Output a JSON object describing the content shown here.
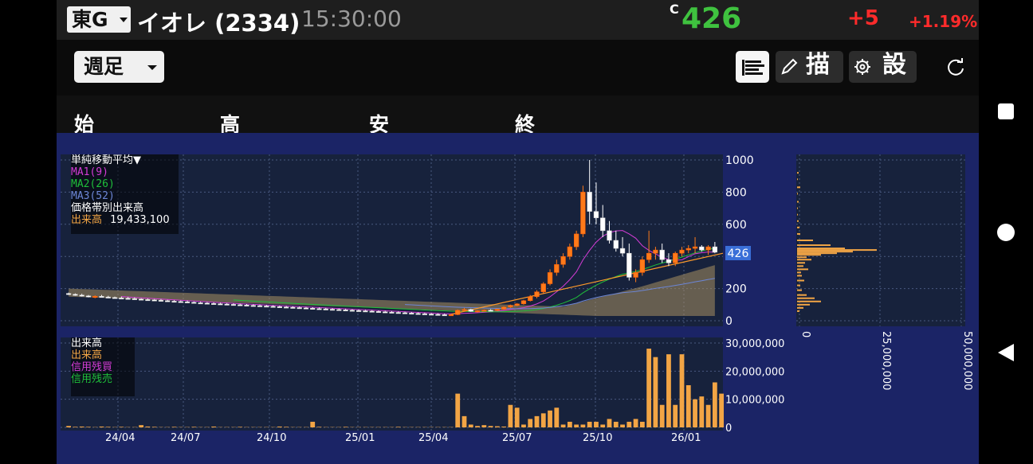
{
  "header": {
    "market": "東G",
    "title": "イオレ (2334)",
    "time": "15:30:00",
    "c_mark": "C",
    "price": "426",
    "change": "+5",
    "change_pct": "+1.19%"
  },
  "toolbar": {
    "period": "週足",
    "draw_label": "描",
    "settings_label": "設"
  },
  "ohlc_labels": [
    "始",
    "高",
    "安",
    "終"
  ],
  "legend_main": {
    "indicator": "単純移動平均▼",
    "ma1": "MA1(9)",
    "ma2": "MA2(26)",
    "ma3": "MA3(52)",
    "vol_profile": "価格帯別出来高",
    "volume_label": "出来高",
    "volume_value": "19,433,100"
  },
  "legend_volume": {
    "title": "出来高",
    "volume": "出来高",
    "margin_buy": "信用残買",
    "margin_sell": "信用残売"
  },
  "current_price_tag": "426",
  "colors": {
    "up": "#ff7a1a",
    "down": "#ffffff",
    "ma1": "#d43cd6",
    "ma2": "#1fbf3a",
    "ma3": "#6c86d6",
    "volume": "#f2a545",
    "background": "#1b2466",
    "plot": "#17223c"
  },
  "chart_data": {
    "type": "candlestick",
    "x_tick_labels": [
      "24/04",
      "24/07",
      "24/10",
      "25/01",
      "25/04",
      "25/07",
      "25/10",
      "26/01"
    ],
    "price_axis": {
      "ticks": [
        "1000",
        "800",
        "600",
        "400",
        "200",
        "0"
      ],
      "ylim": [
        0,
        1000
      ]
    },
    "volume_axis": {
      "ticks": [
        "30,000,000",
        "20,000,000",
        "10,000,000",
        "0"
      ],
      "ylim": [
        0,
        30000000
      ]
    },
    "profile_axis": {
      "ticks": [
        "0",
        "25,000,000",
        "50,000,000"
      ],
      "xlim": [
        0,
        50000000
      ]
    },
    "candles": [
      [
        170,
        175,
        160,
        165
      ],
      [
        165,
        170,
        155,
        160
      ],
      [
        160,
        168,
        150,
        155
      ],
      [
        155,
        160,
        145,
        150
      ],
      [
        150,
        158,
        140,
        152
      ],
      [
        152,
        160,
        145,
        148
      ],
      [
        148,
        155,
        140,
        145
      ],
      [
        145,
        150,
        138,
        142
      ],
      [
        142,
        150,
        135,
        140
      ],
      [
        140,
        148,
        132,
        138
      ],
      [
        138,
        145,
        130,
        135
      ],
      [
        135,
        140,
        128,
        132
      ],
      [
        132,
        138,
        125,
        130
      ],
      [
        130,
        135,
        122,
        128
      ],
      [
        128,
        135,
        120,
        125
      ],
      [
        125,
        130,
        118,
        122
      ],
      [
        122,
        128,
        115,
        120
      ],
      [
        120,
        126,
        112,
        118
      ],
      [
        118,
        125,
        110,
        115
      ],
      [
        115,
        120,
        108,
        112
      ],
      [
        112,
        118,
        105,
        110
      ],
      [
        110,
        116,
        104,
        108
      ],
      [
        108,
        114,
        102,
        106
      ],
      [
        106,
        112,
        100,
        104
      ],
      [
        104,
        110,
        98,
        102
      ],
      [
        102,
        108,
        96,
        100
      ],
      [
        100,
        106,
        94,
        98
      ],
      [
        98,
        104,
        92,
        96
      ],
      [
        96,
        102,
        90,
        94
      ],
      [
        94,
        100,
        88,
        92
      ],
      [
        92,
        98,
        86,
        90
      ],
      [
        90,
        96,
        85,
        88
      ],
      [
        88,
        94,
        83,
        86
      ],
      [
        86,
        92,
        81,
        84
      ],
      [
        84,
        90,
        80,
        82
      ],
      [
        82,
        88,
        78,
        80
      ],
      [
        80,
        86,
        76,
        78
      ],
      [
        78,
        84,
        74,
        76
      ],
      [
        76,
        82,
        72,
        74
      ],
      [
        74,
        80,
        70,
        72
      ],
      [
        72,
        78,
        68,
        70
      ],
      [
        70,
        76,
        66,
        68
      ],
      [
        68,
        74,
        64,
        66
      ],
      [
        66,
        72,
        62,
        64
      ],
      [
        64,
        70,
        60,
        62
      ],
      [
        62,
        68,
        58,
        60
      ],
      [
        60,
        66,
        56,
        58
      ],
      [
        58,
        64,
        54,
        56
      ],
      [
        56,
        62,
        52,
        54
      ],
      [
        54,
        60,
        50,
        52
      ],
      [
        52,
        58,
        48,
        50
      ],
      [
        50,
        56,
        46,
        48
      ],
      [
        48,
        54,
        44,
        46
      ],
      [
        46,
        52,
        42,
        44
      ],
      [
        44,
        50,
        40,
        42
      ],
      [
        42,
        48,
        38,
        40
      ],
      [
        40,
        46,
        36,
        38
      ],
      [
        38,
        44,
        35,
        36
      ],
      [
        36,
        42,
        34,
        38
      ],
      [
        38,
        70,
        35,
        65
      ],
      [
        65,
        80,
        60,
        70
      ],
      [
        70,
        75,
        55,
        58
      ],
      [
        58,
        66,
        52,
        62
      ],
      [
        62,
        70,
        58,
        66
      ],
      [
        66,
        72,
        60,
        64
      ],
      [
        64,
        75,
        60,
        72
      ],
      [
        72,
        90,
        68,
        85
      ],
      [
        85,
        100,
        80,
        95
      ],
      [
        95,
        110,
        90,
        105
      ],
      [
        105,
        130,
        100,
        125
      ],
      [
        125,
        160,
        120,
        150
      ],
      [
        150,
        190,
        140,
        180
      ],
      [
        180,
        240,
        170,
        230
      ],
      [
        230,
        320,
        220,
        300
      ],
      [
        300,
        380,
        280,
        350
      ],
      [
        350,
        420,
        330,
        400
      ],
      [
        400,
        480,
        380,
        460
      ],
      [
        460,
        560,
        440,
        540
      ],
      [
        540,
        840,
        520,
        800
      ],
      [
        800,
        1000,
        600,
        680
      ],
      [
        680,
        860,
        600,
        640
      ],
      [
        640,
        720,
        520,
        560
      ],
      [
        560,
        620,
        480,
        500
      ],
      [
        500,
        560,
        430,
        450
      ],
      [
        450,
        520,
        400,
        420
      ],
      [
        420,
        480,
        250,
        270
      ],
      [
        270,
        320,
        240,
        300
      ],
      [
        300,
        400,
        280,
        380
      ],
      [
        380,
        560,
        360,
        420
      ],
      [
        420,
        460,
        380,
        440
      ],
      [
        440,
        480,
        360,
        380
      ],
      [
        380,
        420,
        340,
        360
      ],
      [
        360,
        430,
        340,
        420
      ],
      [
        420,
        460,
        400,
        440
      ],
      [
        440,
        470,
        420,
        450
      ],
      [
        450,
        520,
        420,
        460
      ],
      [
        460,
        470,
        430,
        440
      ],
      [
        440,
        470,
        410,
        460
      ],
      [
        460,
        490,
        420,
        426
      ]
    ],
    "volume": [
      0.5,
      0.2,
      0.3,
      0.2,
      0.1,
      0.3,
      0.2,
      0.1,
      0.2,
      0.1,
      0.1,
      0.8,
      0.3,
      0.2,
      0.1,
      0.1,
      0.2,
      0.1,
      0.1,
      0.2,
      0.1,
      0.1,
      0.3,
      0.1,
      0.1,
      0.1,
      0.2,
      0.1,
      0.1,
      0.1,
      0.1,
      0.1,
      0.3,
      0.2,
      0.1,
      0.1,
      0.1,
      2.0,
      0.2,
      0.1,
      0.1,
      0.1,
      0.2,
      0.1,
      0.1,
      0.1,
      0.1,
      0.1,
      0.1,
      0.1,
      0.2,
      0.1,
      0.1,
      0.1,
      0.1,
      0.1,
      0.1,
      0.1,
      0.1,
      12,
      4,
      1,
      0.5,
      0.8,
      0.5,
      0.4,
      0.3,
      8,
      7,
      1,
      3,
      4,
      5,
      6,
      7,
      1,
      2,
      1,
      1,
      2,
      2,
      1,
      3,
      2,
      1,
      2,
      3,
      2,
      28,
      25,
      8,
      26,
      8,
      26,
      15,
      10,
      11,
      8,
      16,
      12
    ],
    "volume_unit": "shares"
  }
}
